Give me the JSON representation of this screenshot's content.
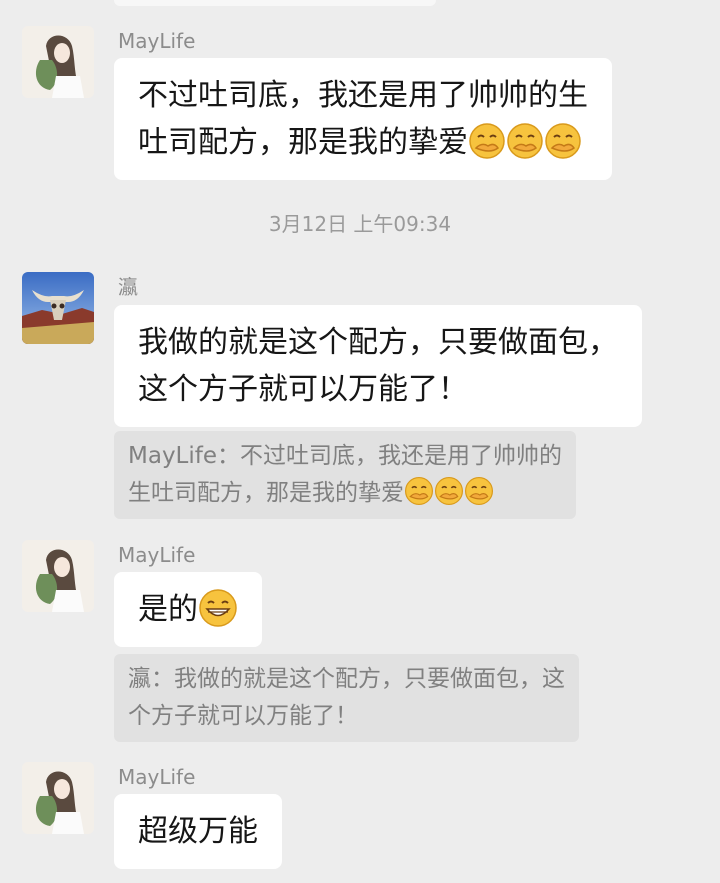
{
  "chat": {
    "messages": [
      {
        "sender": "MayLife",
        "avatar": "maylife-avatar",
        "lines": [
          "不过吐司底，我还是用了帅帅的生",
          "吐司配方，那是我的挚爱"
        ],
        "emoji": [
          "covering-mouth-emoji",
          "covering-mouth-emoji",
          "covering-mouth-emoji"
        ]
      },
      {
        "sender": "瀛",
        "avatar": "bull-skull-avatar",
        "lines": [
          "我做的就是这个配方，只要做面包，",
          "这个方子就可以万能了！"
        ],
        "quote": {
          "lines": [
            "MayLife：不过吐司底，我还是用了帅帅的",
            "生吐司配方，那是我的挚爱"
          ],
          "emoji": [
            "covering-mouth-emoji",
            "covering-mouth-emoji",
            "covering-mouth-emoji"
          ]
        }
      },
      {
        "sender": "MayLife",
        "avatar": "maylife-avatar",
        "lines": [
          "是的"
        ],
        "emoji": [
          "grinning-emoji"
        ],
        "quote": {
          "lines": [
            "瀛：我做的就是这个配方，只要做面包，这",
            "个方子就可以万能了！"
          ]
        }
      },
      {
        "sender": "MayLife",
        "avatar": "maylife-avatar",
        "lines": [
          "超级万能"
        ]
      }
    ],
    "timestamp": "3月12日 上午09:34"
  },
  "colors": {
    "background": "#ededed",
    "bubble": "#ffffff",
    "quote": "#e1e1e1",
    "name": "#8c8c8c",
    "text": "#161616"
  }
}
